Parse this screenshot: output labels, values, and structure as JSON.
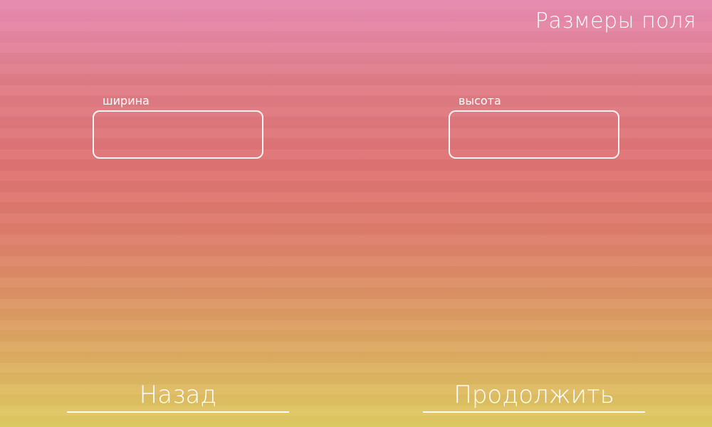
{
  "screen": {
    "title": "Размеры поля"
  },
  "fields": {
    "width": {
      "label": "ширина",
      "value": "",
      "placeholder": ""
    },
    "height": {
      "label": "высота",
      "value": "",
      "placeholder": ""
    }
  },
  "buttons": {
    "back_label": "Назад",
    "continue_label": "Продолжить"
  },
  "colors": {
    "background_top": "#e488a8",
    "background_middle": "#df7374",
    "background_bottom": "#e0cc62",
    "foreground": "#ffffff"
  }
}
